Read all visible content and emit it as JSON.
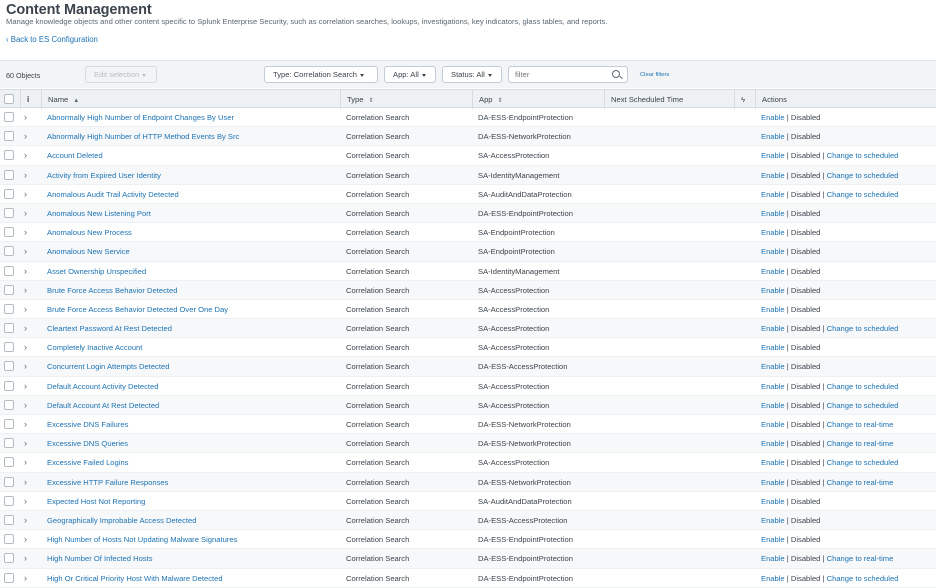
{
  "header": {
    "title": "Content Management",
    "description": "Manage knowledge objects and other content specific to Splunk Enterprise Security, such as correlation searches, lookups, investigations, key indicators, glass tables, and reports.",
    "back_link": "‹ Back to ES Configuration"
  },
  "toolbar": {
    "count": "60 Objects",
    "edit_selection": "Edit selection",
    "type_filter": "Type: Correlation Search",
    "app_filter": "App: All",
    "status_filter": "Status: All",
    "filter_placeholder": "filter",
    "clear_filters": "Clear filters"
  },
  "columns": {
    "info": "i",
    "name": "Name",
    "name_sort": "▲",
    "type": "Type",
    "type_sort": "⇕",
    "app": "App",
    "app_sort": "⇕",
    "next_scheduled": "Next Scheduled Time",
    "bolt": "ϟ",
    "actions": "Actions"
  },
  "labels": {
    "enable": "Enable",
    "disabled": "Disabled",
    "separator": " | "
  },
  "rows": [
    {
      "name": "Abnormally High Number of Endpoint Changes By User",
      "type": "Correlation Search",
      "app": "DA-ESS-EndpointProtection",
      "change": ""
    },
    {
      "name": "Abnormally High Number of HTTP Method Events By Src",
      "type": "Correlation Search",
      "app": "DA-ESS-NetworkProtection",
      "change": ""
    },
    {
      "name": "Account Deleted",
      "type": "Correlation Search",
      "app": "SA-AccessProtection",
      "change": "Change to scheduled"
    },
    {
      "name": "Activity from Expired User Identity",
      "type": "Correlation Search",
      "app": "SA-IdentityManagement",
      "change": "Change to scheduled"
    },
    {
      "name": "Anomalous Audit Trail Activity Detected",
      "type": "Correlation Search",
      "app": "SA-AuditAndDataProtection",
      "change": "Change to scheduled"
    },
    {
      "name": "Anomalous New Listening Port",
      "type": "Correlation Search",
      "app": "DA-ESS-EndpointProtection",
      "change": ""
    },
    {
      "name": "Anomalous New Process",
      "type": "Correlation Search",
      "app": "SA-EndpointProtection",
      "change": ""
    },
    {
      "name": "Anomalous New Service",
      "type": "Correlation Search",
      "app": "SA-EndpointProtection",
      "change": ""
    },
    {
      "name": "Asset Ownership Unspecified",
      "type": "Correlation Search",
      "app": "SA-IdentityManagement",
      "change": ""
    },
    {
      "name": "Brute Force Access Behavior Detected",
      "type": "Correlation Search",
      "app": "SA-AccessProtection",
      "change": ""
    },
    {
      "name": "Brute Force Access Behavior Detected Over One Day",
      "type": "Correlation Search",
      "app": "SA-AccessProtection",
      "change": ""
    },
    {
      "name": "Cleartext Password At Rest Detected",
      "type": "Correlation Search",
      "app": "SA-AccessProtection",
      "change": "Change to scheduled"
    },
    {
      "name": "Completely Inactive Account",
      "type": "Correlation Search",
      "app": "SA-AccessProtection",
      "change": ""
    },
    {
      "name": "Concurrent Login Attempts Detected",
      "type": "Correlation Search",
      "app": "DA-ESS-AccessProtection",
      "change": ""
    },
    {
      "name": "Default Account Activity Detected",
      "type": "Correlation Search",
      "app": "SA-AccessProtection",
      "change": "Change to scheduled"
    },
    {
      "name": "Default Account At Rest Detected",
      "type": "Correlation Search",
      "app": "SA-AccessProtection",
      "change": "Change to scheduled"
    },
    {
      "name": "Excessive DNS Failures",
      "type": "Correlation Search",
      "app": "DA-ESS-NetworkProtection",
      "change": "Change to real-time"
    },
    {
      "name": "Excessive DNS Queries",
      "type": "Correlation Search",
      "app": "DA-ESS-NetworkProtection",
      "change": "Change to real-time"
    },
    {
      "name": "Excessive Failed Logins",
      "type": "Correlation Search",
      "app": "SA-AccessProtection",
      "change": "Change to scheduled"
    },
    {
      "name": "Excessive HTTP Failure Responses",
      "type": "Correlation Search",
      "app": "DA-ESS-NetworkProtection",
      "change": "Change to real-time"
    },
    {
      "name": "Expected Host Not Reporting",
      "type": "Correlation Search",
      "app": "SA-AuditAndDataProtection",
      "change": ""
    },
    {
      "name": "Geographically Improbable Access Detected",
      "type": "Correlation Search",
      "app": "DA-ESS-AccessProtection",
      "change": ""
    },
    {
      "name": "High Number of Hosts Not Updating Malware Signatures",
      "type": "Correlation Search",
      "app": "DA-ESS-EndpointProtection",
      "change": ""
    },
    {
      "name": "High Number Of Infected Hosts",
      "type": "Correlation Search",
      "app": "DA-ESS-EndpointProtection",
      "change": "Change to real-time"
    },
    {
      "name": "High Or Critical Priority Host With Malware Detected",
      "type": "Correlation Search",
      "app": "DA-ESS-EndpointProtection",
      "change": "Change to scheduled"
    }
  ]
}
